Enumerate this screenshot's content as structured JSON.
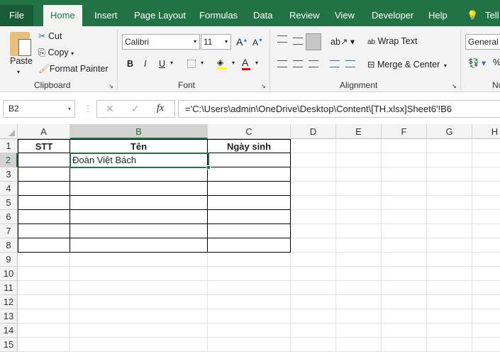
{
  "tabs": [
    {
      "label": "File"
    },
    {
      "label": "Home"
    },
    {
      "label": "Insert"
    },
    {
      "label": "Page Layout"
    },
    {
      "label": "Formulas"
    },
    {
      "label": "Data"
    },
    {
      "label": "Review"
    },
    {
      "label": "View"
    },
    {
      "label": "Developer"
    },
    {
      "label": "Help"
    },
    {
      "label": "Tell"
    }
  ],
  "clipboard": {
    "paste": "Paste",
    "cut": "Cut",
    "copy": "Copy",
    "format_painter": "Format Painter",
    "group": "Clipboard"
  },
  "font": {
    "name": "Calibri",
    "size": "11",
    "bold": "B",
    "italic": "I",
    "underline": "U",
    "group": "Font",
    "fill_color": "#ffff00",
    "font_color": "#ff0000"
  },
  "alignment": {
    "wrap": "Wrap Text",
    "merge": "Merge & Center",
    "group": "Alignment"
  },
  "number": {
    "format": "General",
    "group": "Nu",
    "percent": "%"
  },
  "formula_bar": {
    "name_box": "B2",
    "fx": "fx",
    "formula": "='C:\\Users\\admin\\OneDrive\\Desktop\\Content\\[TH.xlsx]Sheet6'!B6"
  },
  "sheet": {
    "columns": [
      "A",
      "B",
      "C",
      "D",
      "E",
      "F",
      "G",
      "H"
    ],
    "rows": [
      "1",
      "2",
      "3",
      "4",
      "5",
      "6",
      "7",
      "8",
      "9",
      "10",
      "11",
      "12",
      "13",
      "14",
      "15"
    ],
    "cells": {
      "A1": "STT",
      "B1": "Tên",
      "C1": "Ngày sinh",
      "B2": "Đoàn Việt Bách"
    },
    "selected": "B2"
  }
}
